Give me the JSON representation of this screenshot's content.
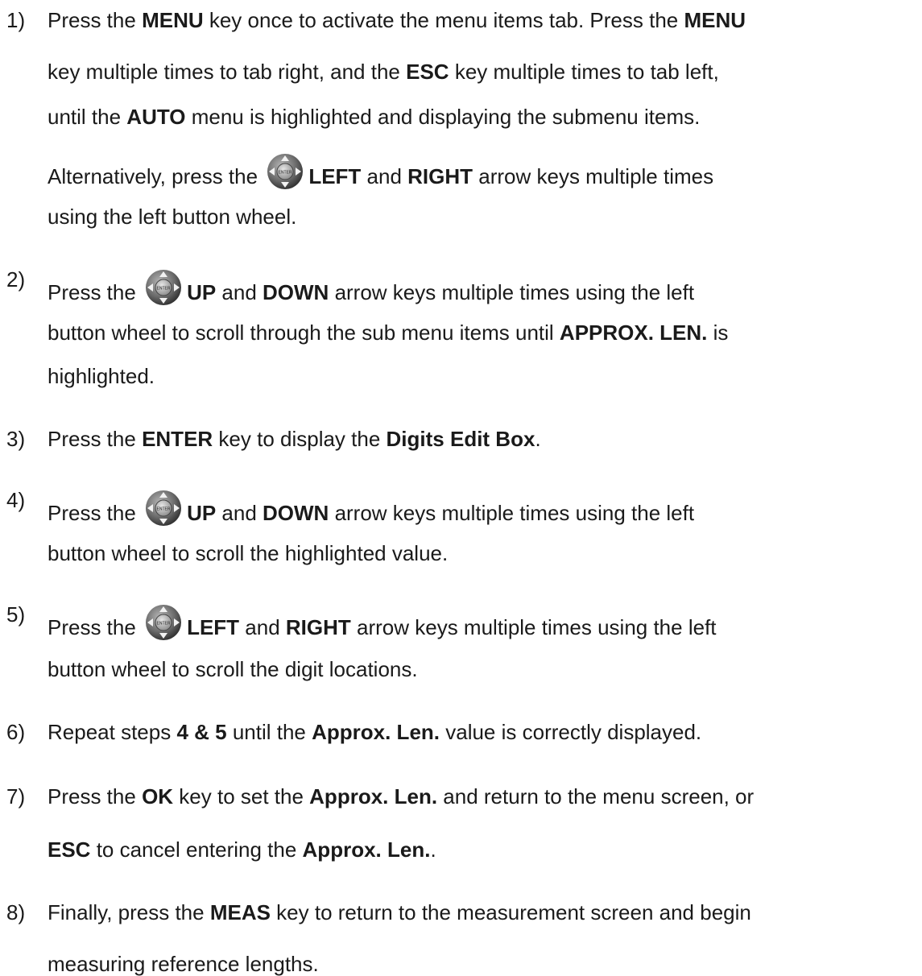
{
  "steps": [
    {
      "num": "1)",
      "lines": [
        [
          {
            "t": "Press the "
          },
          {
            "t": "MENU",
            "b": true
          },
          {
            "t": " key once to activate the menu items tab.  Press the "
          },
          {
            "t": "MENU",
            "b": true
          }
        ],
        [
          {
            "t": "key multiple times to tab right, and the "
          },
          {
            "t": "ESC",
            "b": true
          },
          {
            "t": " key multiple times to tab left,"
          }
        ],
        [
          {
            "t": "until the "
          },
          {
            "t": "AUTO",
            "b": true
          },
          {
            "t": " menu is highlighted and displaying the submenu items."
          }
        ],
        [
          {
            "t": "Alternatively, press the "
          },
          {
            "icon": "button-wheel-icon"
          },
          {
            "t": "LEFT",
            "b": true
          },
          {
            "t": " and "
          },
          {
            "t": "RIGHT",
            "b": true
          },
          {
            "t": " arrow keys multiple times"
          }
        ],
        [
          {
            "t": "using the left button wheel."
          }
        ]
      ]
    },
    {
      "num": "2)",
      "lines": [
        [
          {
            "t": "Press the "
          },
          {
            "icon": "button-wheel-icon"
          },
          {
            "t": "UP",
            "b": true
          },
          {
            "t": " and "
          },
          {
            "t": "DOWN",
            "b": true
          },
          {
            "t": " arrow keys multiple times using the left"
          }
        ],
        [
          {
            "t": "button wheel to scroll through the sub menu items until "
          },
          {
            "t": "APPROX. LEN.",
            "b": true
          },
          {
            "t": " is"
          }
        ],
        [
          {
            "t": "highlighted."
          }
        ]
      ]
    },
    {
      "num": "3)",
      "lines": [
        [
          {
            "t": "Press the "
          },
          {
            "t": "ENTER",
            "b": true
          },
          {
            "t": " key to display the "
          },
          {
            "t": "Digits Edit Box",
            "b": true
          },
          {
            "t": "."
          }
        ]
      ]
    },
    {
      "num": "4)",
      "lines": [
        [
          {
            "t": "Press the "
          },
          {
            "icon": "button-wheel-icon"
          },
          {
            "t": "UP",
            "b": true
          },
          {
            "t": " and "
          },
          {
            "t": "DOWN",
            "b": true
          },
          {
            "t": " arrow keys multiple times using the left"
          }
        ],
        [
          {
            "t": "button wheel to scroll the highlighted value."
          }
        ]
      ]
    },
    {
      "num": "5)",
      "lines": [
        [
          {
            "t": "Press the "
          },
          {
            "icon": "button-wheel-icon"
          },
          {
            "t": "LEFT",
            "b": true
          },
          {
            "t": " and "
          },
          {
            "t": "RIGHT",
            "b": true
          },
          {
            "t": " arrow keys multiple times using the left"
          }
        ],
        [
          {
            "t": "button wheel to scroll the digit locations."
          }
        ]
      ]
    },
    {
      "num": "6)",
      "lines": [
        [
          {
            "t": "Repeat steps "
          },
          {
            "t": "4 & 5",
            "b": true
          },
          {
            "t": " until the "
          },
          {
            "t": "Approx. Len.",
            "b": true
          },
          {
            "t": " value is correctly displayed."
          }
        ]
      ]
    },
    {
      "num": "7)",
      "lines": [
        [
          {
            "t": "Press the "
          },
          {
            "t": "OK",
            "b": true
          },
          {
            "t": " key to set the "
          },
          {
            "t": "Approx. Len.",
            "b": true
          },
          {
            "t": " and return to the menu screen, or"
          }
        ],
        [
          {
            "t": "ESC",
            "b": true
          },
          {
            "t": " to cancel entering the "
          },
          {
            "t": "Approx. Len.",
            "b": true
          },
          {
            "t": "."
          }
        ]
      ]
    },
    {
      "num": "8)",
      "lines": [
        [
          {
            "t": "Finally, press the "
          },
          {
            "t": "MEAS",
            "b": true
          },
          {
            "t": " key to return to the measurement screen and begin"
          }
        ],
        [
          {
            "t": "measuring reference lengths."
          }
        ]
      ]
    }
  ]
}
